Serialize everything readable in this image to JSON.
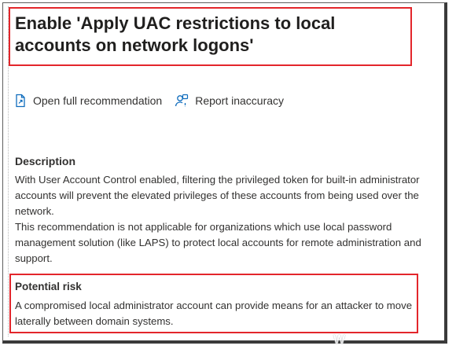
{
  "panel": {
    "title": "Enable 'Apply UAC restrictions to local accounts on network logons'",
    "actions": [
      {
        "label": "Open full recommendation",
        "icon": "document-icon"
      },
      {
        "label": "Report inaccuracy",
        "icon": "person-feedback-icon"
      }
    ],
    "description": {
      "heading": "Description",
      "paragraphs": [
        "With User Account Control enabled, filtering the privileged token for built-in administrator accounts will prevent the elevated privileges of these accounts from being used over the network.",
        "This recommendation is not applicable for organizations which use local password management solution (like LAPS) to protect local accounts for remote administration and support."
      ]
    },
    "risk": {
      "heading": "Potential risk",
      "text": "A compromised local administrator account can provide means for an attacker to move laterally between domain systems."
    }
  },
  "colors": {
    "highlight": "#e3262b",
    "icon": "#0f6cbd",
    "text": "#323130"
  }
}
